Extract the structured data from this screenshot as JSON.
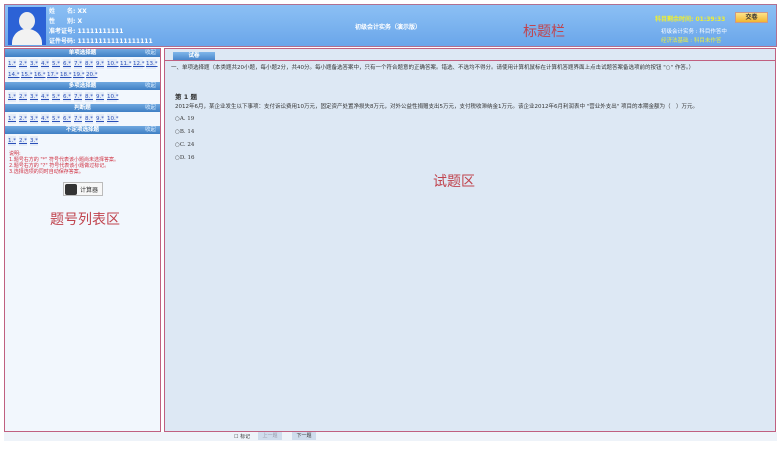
{
  "header": {
    "name_label": "姓　　名: XX",
    "gender_label": "性　　别: X",
    "ticket_label": "准考证号: 11111111111",
    "id_label": "证件号码: 111111111111111111",
    "title": "初级会计实务（演示版）",
    "annotation": "标题栏",
    "timer": "科目剩余时间: 01:39:33",
    "submit": "交卷",
    "subjects": [
      {
        "name": "初级会计实务 :",
        "status": "科目作答中"
      },
      {
        "name": "经济法基础 :",
        "status": "科目未作答"
      }
    ]
  },
  "sidebar": {
    "collapse": "收起",
    "sections": [
      {
        "title": "单项选择题",
        "nums": [
          "1.*",
          "2.*",
          "3.*",
          "4.*",
          "5.*",
          "6.*",
          "7.*",
          "8.*",
          "9.*",
          "10.*",
          "11.*",
          "12.*",
          "13.*",
          "14.*",
          "15.*",
          "16.*",
          "17.*",
          "18.*",
          "19.*",
          "20.*"
        ]
      },
      {
        "title": "多项选择题",
        "nums": [
          "1.*",
          "2.*",
          "3.*",
          "4.*",
          "5.*",
          "6.*",
          "7.*",
          "8.*",
          "9.*",
          "10.*"
        ]
      },
      {
        "title": "判断题",
        "nums": [
          "1.*",
          "2.*",
          "3.*",
          "4.*",
          "5.*",
          "6.*",
          "7.*",
          "8.*",
          "9.*",
          "10.*"
        ]
      },
      {
        "title": "不定项选择题",
        "nums": [
          "1.*",
          "2.*",
          "3.*"
        ]
      }
    ],
    "notes": [
      "说明:",
      "1.题号右方的 \"*\" 符号代表该小题尚未选择答案。",
      "2.题号右方的 \"?\" 符号代表该小题做过标记。",
      "3.选择选项的同时自动保存答案。"
    ],
    "calculator": "计算器",
    "annotation": "题号列表区"
  },
  "main": {
    "tab": "试卷",
    "intro": "一、单项选择题（本类题共20小题，每小题2分，共40分。每小题备选答案中，只有一个符合题意的正确答案。错选、不选均不得分。请使用计算机鼠标在计算机答题界面上点击试题答案备选项前的按钮 \"○\" 作答。）",
    "question_title": "第 1 题",
    "question_text": "2012年6月，某企业发生以下事项：支付诉讼费用10万元，固定资产处置净损失8万元，对外公益性捐赠支出5万元，支付税收滞纳金1万元。该企业2012年6月利润表中 \"营业外支出\" 项目的本期金额为（　）万元。",
    "options": [
      "A. 19",
      "B. 14",
      "C. 24",
      "D. 16"
    ],
    "annotation": "试题区"
  },
  "footer": {
    "mark": "标记",
    "prev": "上一题",
    "next": "下一题"
  }
}
